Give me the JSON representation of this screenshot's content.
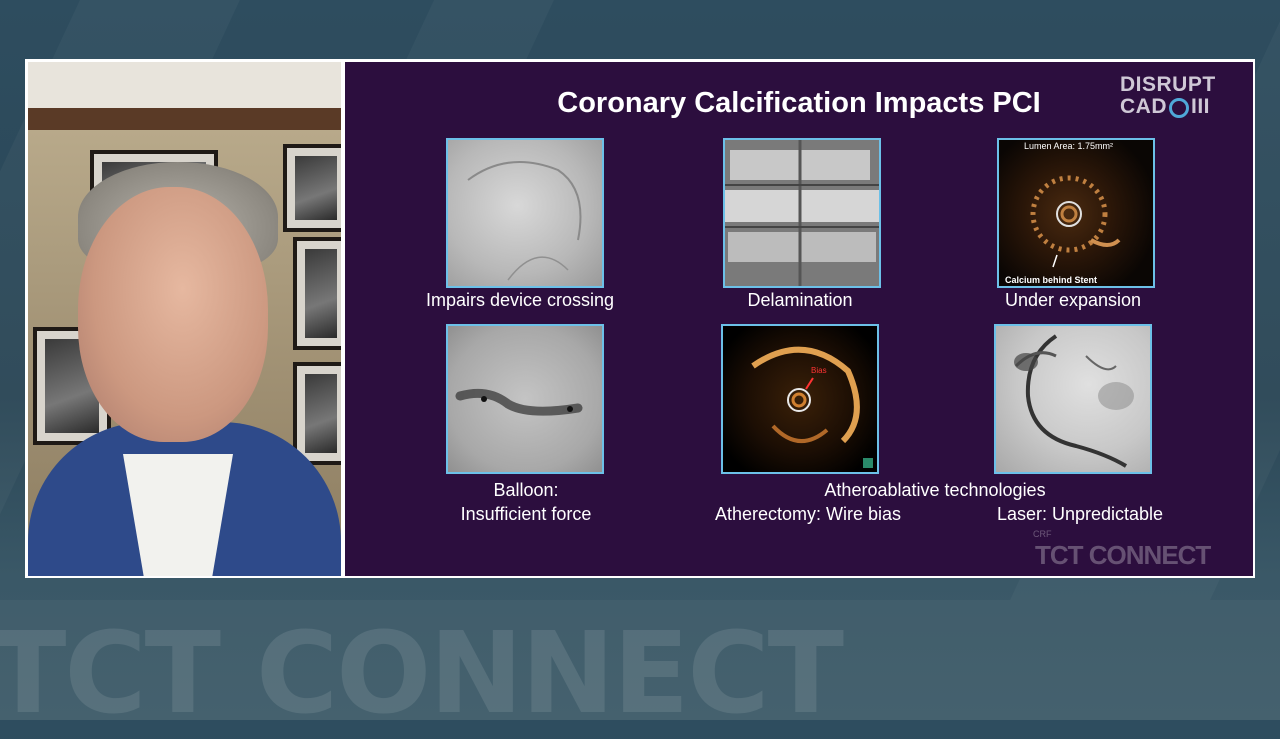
{
  "slide": {
    "title": "Coronary Calcification Impacts PCI",
    "logo_line1": "DISRUPT",
    "logo_line2_left": "CAD",
    "logo_line2_right": "III",
    "panels": [
      {
        "caption": "Impairs device crossing"
      },
      {
        "caption": "Delamination"
      },
      {
        "caption": "Under expansion",
        "image_label_top": "Lumen Area: 1.75mm²",
        "image_label_bottom": "Calcium behind Stent"
      },
      {
        "caption_line1": "Balloon:",
        "caption_line2": "Insufficient force"
      },
      {
        "image_label": "Bias"
      },
      {}
    ],
    "group_caption": "Atheroablative technologies",
    "sub_caption_left": "Atherectomy: Wire bias",
    "sub_caption_right": "Laser: Unpredictable",
    "watermark_small": "CRF",
    "watermark": "TCT CONNECT"
  },
  "background": {
    "watermark": "TCT CONNECT"
  },
  "colors": {
    "slide_bg": "#2c0e3e",
    "image_border": "#6cc0e8",
    "frame": "#ffffff"
  }
}
